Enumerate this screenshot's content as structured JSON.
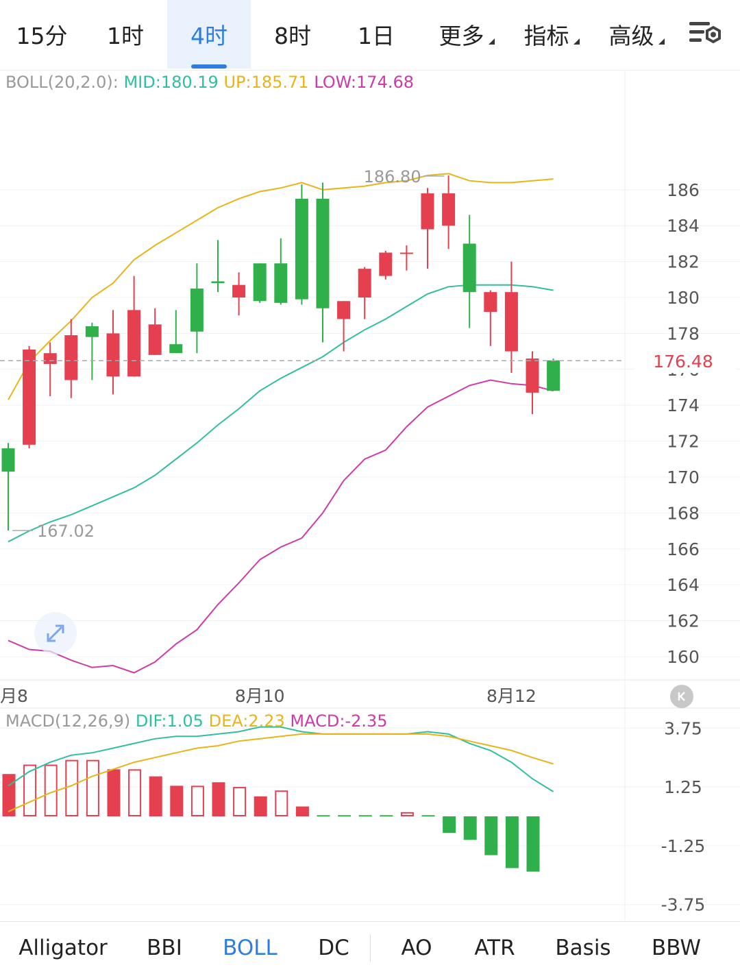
{
  "colors": {
    "up": "#e5404f",
    "down": "#2fb04a",
    "mid": "#2fbfa0",
    "upper": "#e8b418",
    "lower": "#cf3aa8",
    "dif": "#2fbfa0",
    "dea": "#e8b418",
    "accent": "#2f7de1",
    "price_tag": "#e5404f",
    "axis_text": "#555555",
    "grid": "#f0f0f0"
  },
  "timeframes": [
    {
      "label": "15分",
      "active": false
    },
    {
      "label": "1时",
      "active": false
    },
    {
      "label": "4时",
      "active": true
    },
    {
      "label": "8时",
      "active": false
    },
    {
      "label": "1日",
      "active": false
    },
    {
      "label": "更多",
      "dropdown": true
    },
    {
      "label": "指标",
      "dropdown": true
    },
    {
      "label": "高级",
      "dropdown": true
    }
  ],
  "settings_icon": "chart-settings-icon",
  "boll_legend": {
    "prefix": "BOLL(20,2.0):",
    "mid": "MID:180.19",
    "up": "UP:185.71",
    "low": "LOW:174.68"
  },
  "macd_legend": {
    "prefix": "MACD(12,26,9)",
    "dif": "DIF:1.05",
    "dea": "DEA:2.23",
    "macd": "MACD:-2.35"
  },
  "chart_data": [
    {
      "type": "candlestick",
      "y_ticks": [
        186,
        184,
        182,
        180,
        178,
        176,
        174,
        172,
        170,
        168,
        166,
        164,
        162,
        160
      ],
      "ylim": [
        158.7,
        191.3
      ],
      "x_labels": [
        {
          "label": "月8",
          "index": 0
        },
        {
          "label": "8月10",
          "index": 12
        },
        {
          "label": "8月12",
          "index": 24
        }
      ],
      "current_price": 176.48,
      "current_price_label": "176.48",
      "high_annotation": {
        "label": "186.80",
        "index": 21,
        "value": 186.8
      },
      "low_annotation": {
        "label": "167.02",
        "index": 0,
        "value": 167.02
      },
      "candles": [
        {
          "o": 171.6,
          "h": 171.9,
          "l": 167.02,
          "c": 170.3
        },
        {
          "o": 171.8,
          "h": 177.3,
          "l": 171.6,
          "c": 177.1
        },
        {
          "o": 176.3,
          "h": 177.5,
          "l": 174.5,
          "c": 176.9
        },
        {
          "o": 175.4,
          "h": 178.8,
          "l": 174.4,
          "c": 177.9
        },
        {
          "o": 178.4,
          "h": 178.6,
          "l": 175.4,
          "c": 177.8
        },
        {
          "o": 175.6,
          "h": 179.3,
          "l": 174.6,
          "c": 178.0
        },
        {
          "o": 175.6,
          "h": 181.2,
          "l": 175.6,
          "c": 179.3
        },
        {
          "o": 176.8,
          "h": 179.4,
          "l": 176.8,
          "c": 178.5
        },
        {
          "o": 177.4,
          "h": 179.3,
          "l": 176.9,
          "c": 176.9
        },
        {
          "o": 180.5,
          "h": 181.9,
          "l": 176.9,
          "c": 178.1
        },
        {
          "o": 180.9,
          "h": 183.2,
          "l": 180.3,
          "c": 180.8
        },
        {
          "o": 180.0,
          "h": 181.4,
          "l": 179.0,
          "c": 180.7
        },
        {
          "o": 181.9,
          "h": 181.9,
          "l": 179.7,
          "c": 179.8
        },
        {
          "o": 181.9,
          "h": 183.3,
          "l": 179.6,
          "c": 179.7
        },
        {
          "o": 185.5,
          "h": 186.3,
          "l": 179.6,
          "c": 179.9
        },
        {
          "o": 185.5,
          "h": 186.4,
          "l": 177.5,
          "c": 179.4
        },
        {
          "o": 178.8,
          "h": 179.8,
          "l": 177.0,
          "c": 179.8
        },
        {
          "o": 180.0,
          "h": 181.7,
          "l": 178.8,
          "c": 181.6
        },
        {
          "o": 181.2,
          "h": 182.6,
          "l": 181.0,
          "c": 182.5
        },
        {
          "o": 182.5,
          "h": 182.9,
          "l": 181.5,
          "c": 182.5
        },
        {
          "o": 183.8,
          "h": 186.1,
          "l": 181.6,
          "c": 185.8
        },
        {
          "o": 184.0,
          "h": 186.8,
          "l": 182.7,
          "c": 185.8
        },
        {
          "o": 183.0,
          "h": 184.6,
          "l": 178.3,
          "c": 180.3
        },
        {
          "o": 179.2,
          "h": 180.4,
          "l": 177.3,
          "c": 180.3
        },
        {
          "o": 177.0,
          "h": 182.0,
          "l": 175.8,
          "c": 180.3
        },
        {
          "o": 174.7,
          "h": 177.0,
          "l": 173.5,
          "c": 176.6
        },
        {
          "o": 176.5,
          "h": 176.6,
          "l": 174.8,
          "c": 174.8
        }
      ],
      "series": [
        {
          "key": "upper",
          "values": [
            174.3,
            176.4,
            177.6,
            178.7,
            180.0,
            180.8,
            182.1,
            182.9,
            183.6,
            184.3,
            185.0,
            185.5,
            185.9,
            186.1,
            186.4,
            186.0,
            186.1,
            186.2,
            186.4,
            186.5,
            186.8,
            186.9,
            186.5,
            186.4,
            186.4,
            186.5,
            186.6
          ]
        },
        {
          "key": "mid",
          "values": [
            166.4,
            167.0,
            167.5,
            167.9,
            168.4,
            168.9,
            169.4,
            170.1,
            171.0,
            171.9,
            172.9,
            173.8,
            174.8,
            175.5,
            176.1,
            176.7,
            177.5,
            178.2,
            178.8,
            179.5,
            180.2,
            180.6,
            180.7,
            180.7,
            180.7,
            180.6,
            180.4
          ]
        },
        {
          "key": "lower",
          "values": [
            160.9,
            160.4,
            160.3,
            159.8,
            159.4,
            159.5,
            159.1,
            159.7,
            160.7,
            161.5,
            162.9,
            164.1,
            165.4,
            166.1,
            166.6,
            168.0,
            169.8,
            171.0,
            171.5,
            172.8,
            173.9,
            174.5,
            175.1,
            175.4,
            175.2,
            175.1,
            174.8
          ]
        }
      ]
    },
    {
      "type": "macd",
      "y_ticks": [
        3.75,
        1.25,
        -1.25,
        -3.75
      ],
      "y_tick_labels": [
        "3.75",
        "1.25",
        "-1.25",
        "-3.75"
      ],
      "ylim": [
        -4.4,
        4.4
      ],
      "histogram": [
        1.8,
        2.2,
        2.2,
        2.4,
        2.4,
        2.0,
        2.0,
        1.7,
        1.3,
        1.3,
        1.45,
        1.25,
        0.85,
        1.1,
        0.42,
        0.05,
        0.05,
        0.05,
        0.05,
        0.18,
        0.05,
        -0.7,
        -1.0,
        -1.65,
        -2.2,
        -2.35
      ],
      "histogram_hollow": [
        false,
        true,
        true,
        true,
        true,
        false,
        true,
        false,
        false,
        true,
        false,
        true,
        false,
        true,
        false,
        false,
        false,
        false,
        false,
        true,
        false,
        false,
        false,
        false,
        false,
        false
      ],
      "histogram_colors": [
        "up",
        "up",
        "up",
        "up",
        "up",
        "up",
        "up",
        "up",
        "up",
        "up",
        "up",
        "up",
        "up",
        "up",
        "up",
        "down",
        "down",
        "down",
        "down",
        "up",
        "down",
        "down",
        "down",
        "down",
        "down",
        "down"
      ],
      "series": [
        {
          "key": "dif",
          "values": [
            1.3,
            1.9,
            2.3,
            2.6,
            2.7,
            2.9,
            3.1,
            3.3,
            3.4,
            3.4,
            3.5,
            3.6,
            3.8,
            3.8,
            3.6,
            3.5,
            3.5,
            3.5,
            3.5,
            3.5,
            3.6,
            3.5,
            3.1,
            2.8,
            2.3,
            1.6,
            1.05
          ]
        },
        {
          "key": "dea",
          "values": [
            0.2,
            0.6,
            1.0,
            1.3,
            1.7,
            2.0,
            2.3,
            2.5,
            2.7,
            2.9,
            3.0,
            3.2,
            3.3,
            3.4,
            3.5,
            3.5,
            3.5,
            3.5,
            3.5,
            3.5,
            3.5,
            3.4,
            3.2,
            3.0,
            2.8,
            2.5,
            2.23
          ]
        }
      ]
    }
  ],
  "indicator_tabs": [
    {
      "label": "Alligator",
      "active": false
    },
    {
      "label": "BBI",
      "active": false
    },
    {
      "label": "BOLL",
      "active": true
    },
    {
      "label": "DC",
      "active": false
    },
    {
      "label": "AO",
      "active": false
    },
    {
      "label": "ATR",
      "active": false
    },
    {
      "label": "Basis",
      "active": false
    },
    {
      "label": "BBW",
      "active": false
    }
  ]
}
